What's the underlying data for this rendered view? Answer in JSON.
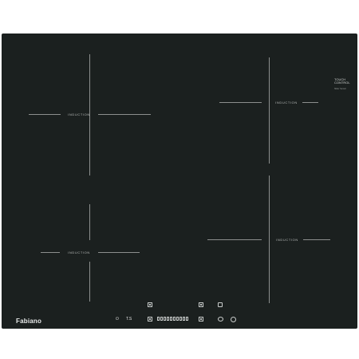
{
  "brand": {
    "name": "Fabiano"
  },
  "top_logo": {
    "line1": "TOUCH",
    "line2": "CONTROL",
    "sub": "Slider Sensor"
  },
  "zones": [
    {
      "label": "INDUCTION"
    },
    {
      "label": "INDUCTION"
    },
    {
      "label": "INDUCTION"
    },
    {
      "label": "INDUCTION"
    }
  ],
  "controls": {
    "power_symbol": "⏻",
    "timer_text": "T.S",
    "slider_segments": 10
  },
  "colors": {
    "glass": "#1b201f",
    "markings": "#8c8f8e",
    "text": "#e0e2e1"
  }
}
